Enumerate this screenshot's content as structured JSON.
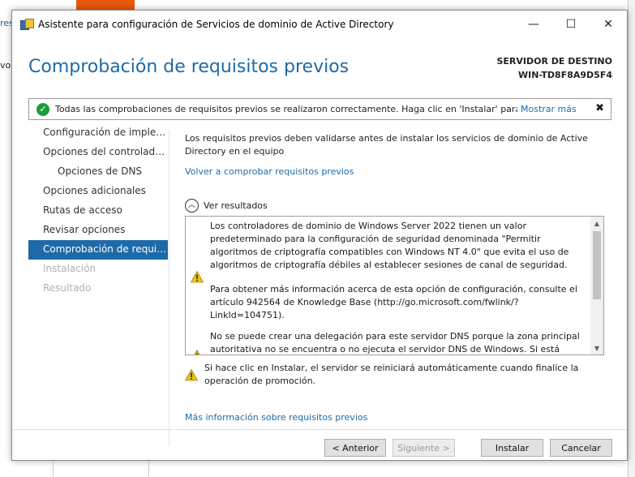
{
  "background": {
    "left_fragment_1": "res",
    "left_fragment_2": "vo"
  },
  "window": {
    "title": "Asistente para configuración de Servicios de dominio de Active Directory",
    "minimize_glyph": "—",
    "maximize_glyph": "☐",
    "close_glyph": "✕"
  },
  "header": {
    "page_title": "Comprobación de requisitos previos",
    "server_label": "SERVIDOR DE DESTINO",
    "server_name": "WIN-TD8F8A9D5F4"
  },
  "notification": {
    "icon": "success-check-icon",
    "text": "Todas las comprobaciones de requisitos previos se realizaron correctamente. Haga clic en 'Instalar' para co...",
    "more_link": "Mostrar más",
    "close_glyph": "✖"
  },
  "nav": {
    "items": [
      {
        "label": "Configuración de implem...",
        "state": "normal",
        "indent": false
      },
      {
        "label": "Opciones del controlador...",
        "state": "normal",
        "indent": false
      },
      {
        "label": "Opciones de DNS",
        "state": "normal",
        "indent": true
      },
      {
        "label": "Opciones adicionales",
        "state": "normal",
        "indent": false
      },
      {
        "label": "Rutas de acceso",
        "state": "normal",
        "indent": false
      },
      {
        "label": "Revisar opciones",
        "state": "normal",
        "indent": false
      },
      {
        "label": "Comprobación de requisi...",
        "state": "active",
        "indent": false
      },
      {
        "label": "Instalación",
        "state": "disabled",
        "indent": false
      },
      {
        "label": "Resultado",
        "state": "disabled",
        "indent": false
      }
    ]
  },
  "content": {
    "intro": "Los requisitos previos deben validarse antes de instalar los servicios de dominio de Active Directory en el equipo",
    "recheck_link": "Volver a comprobar requisitos previos",
    "results_header": "Ver resultados",
    "results": [
      {
        "icon": "warning-icon",
        "paragraphs": [
          "Los controladores de dominio de Windows Server 2022 tienen un valor predeterminado para la configuración de seguridad denominada \"Permitir algoritmos de criptografía compatibles con Windows NT 4.0\" que evita el uso de algoritmos de criptografía débiles al establecer sesiones de canal de seguridad.",
          "Para obtener más información acerca de esta opción de configuración, consulte el artículo 942564 de Knowledge Base (http://go.microsoft.com/fwlink/?LinkId=104751)."
        ]
      },
      {
        "icon": "warning-icon",
        "paragraphs": [
          "No se puede crear una delegación para este servidor DNS porque la zona principal autoritativa no se encuentra o no ejecuta el servidor DNS de Windows. Si está realizando una integración en una infraestructura DNS existente, debe crear"
        ]
      }
    ],
    "restart_warning": "Si hace clic en Instalar, el servidor se reiniciará automáticamente cuando finalice la operación de promoción.",
    "more_info_link": "Más información sobre requisitos previos"
  },
  "buttons": {
    "previous": "< Anterior",
    "next": "Siguiente >",
    "install": "Instalar",
    "cancel": "Cancelar"
  }
}
